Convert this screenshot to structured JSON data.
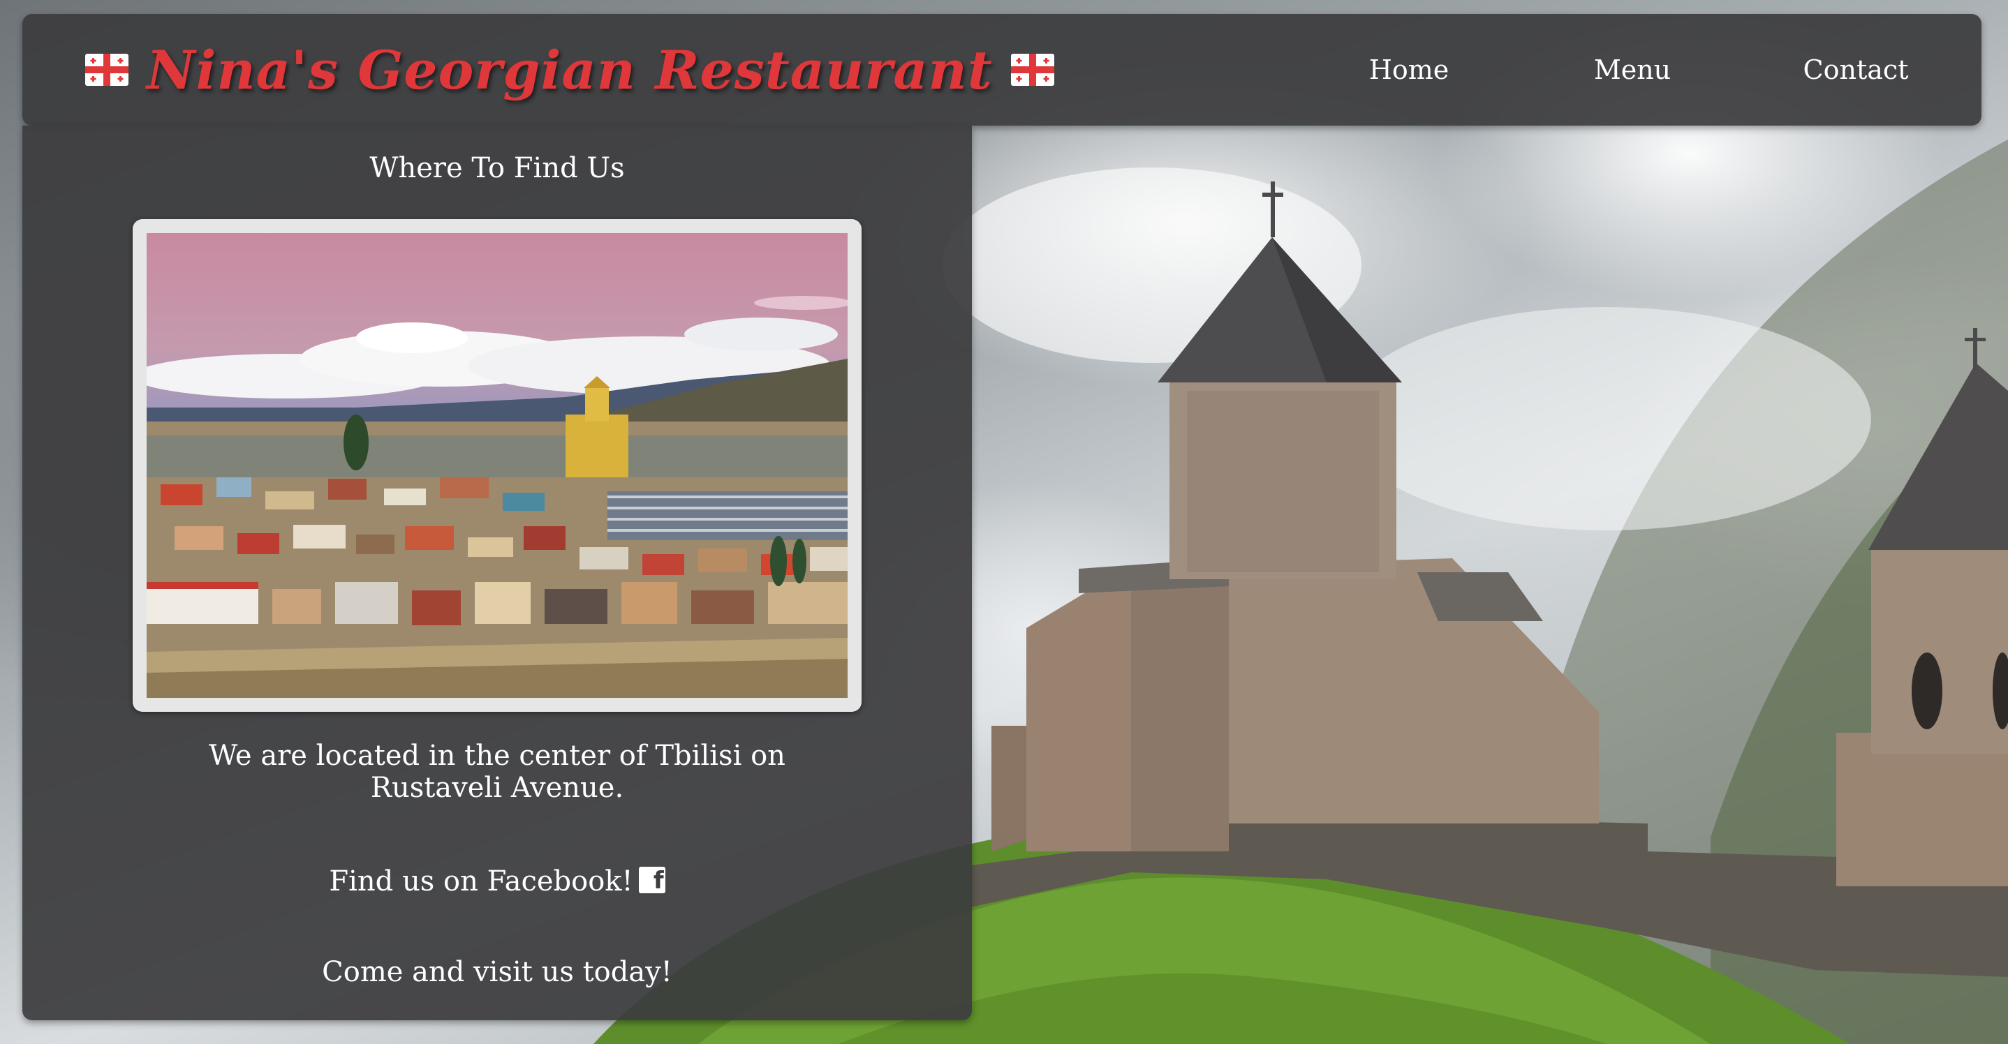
{
  "header": {
    "title": "Nina's Georgian Restaurant",
    "flag_icon": "georgia-flag-icon"
  },
  "nav": {
    "home": "Home",
    "menu": "Menu",
    "contact": "Contact"
  },
  "main": {
    "section_title": "Where To Find Us",
    "photo_alt": "Tbilisi",
    "location_text": "We are located in the center of Tbilisi on Rustaveli Avenue.",
    "facebook_text": "Find us on Facebook!",
    "facebook_icon": "facebook-icon",
    "visit_text": "Come and visit us today!"
  },
  "colors": {
    "title_red": "#e0383a",
    "panel_bg": "#3c3c3e",
    "text": "#ffffff"
  }
}
